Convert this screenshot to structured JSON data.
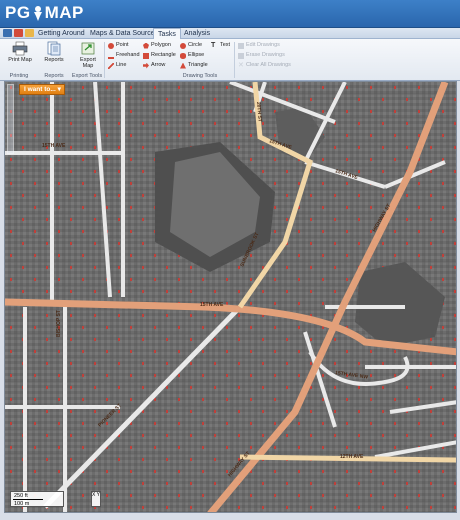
{
  "app": {
    "logo_left": "PG",
    "logo_right": "MAP"
  },
  "tabs": [
    {
      "label": "Getting Around",
      "active": false
    },
    {
      "label": "Maps & Data Sources",
      "active": false
    },
    {
      "label": "Tasks",
      "active": true
    },
    {
      "label": "Analysis",
      "active": false
    }
  ],
  "ribbon": {
    "print_map": "Print Map",
    "reports": "Reports",
    "export_map": "Export Map",
    "drawing": {
      "point": "Point",
      "polygon": "Polygon",
      "circle": "Circle",
      "text": "Text",
      "freehand": "Freehand",
      "rectangle": "Rectangle",
      "ellipse": "Ellipse",
      "line": "Line",
      "arrow": "Arrow",
      "triangle": "Triangle",
      "edit_drawings": "Edit Drawings",
      "erase_drawings": "Erase Drawings",
      "clear_all_drawings": "Clear All Drawings"
    },
    "groups": {
      "printing": "Printing",
      "reports": "Reports",
      "export_tools": "Export Tools",
      "drawing_tools": "Drawing Tools"
    }
  },
  "map": {
    "goto_label": "I want to...",
    "scale_ft": "250 ft",
    "scale_m": "100 m",
    "xy_label": "X Y",
    "roads": {
      "fifteenth_ave": "15TH AVE",
      "fifteenth_ave_east": "15TH AVE",
      "fifteenth_ave_cir": "15TH AVE",
      "fifteenth_ave_nw": "15TH AVE NW",
      "fifteenth_ave_south": "15TH AVE",
      "main_ave": "15TH AVE",
      "twelfth_ave": "12TH AVE",
      "bishop_st": "BISHOP ST",
      "sunbrook_st": "SUNBROOK ST",
      "diagonal_st": "PIONEER ST",
      "highway_north": "HIGHWAY ST",
      "highway_south": "HIGHWAY ST",
      "twentieth_st": "20TH ST"
    }
  },
  "colors": {
    "accent": "#e8832a",
    "titlebar": "#2f6fb8",
    "road_major": "#e2a07a",
    "road_minor": "#f1d6a6"
  }
}
